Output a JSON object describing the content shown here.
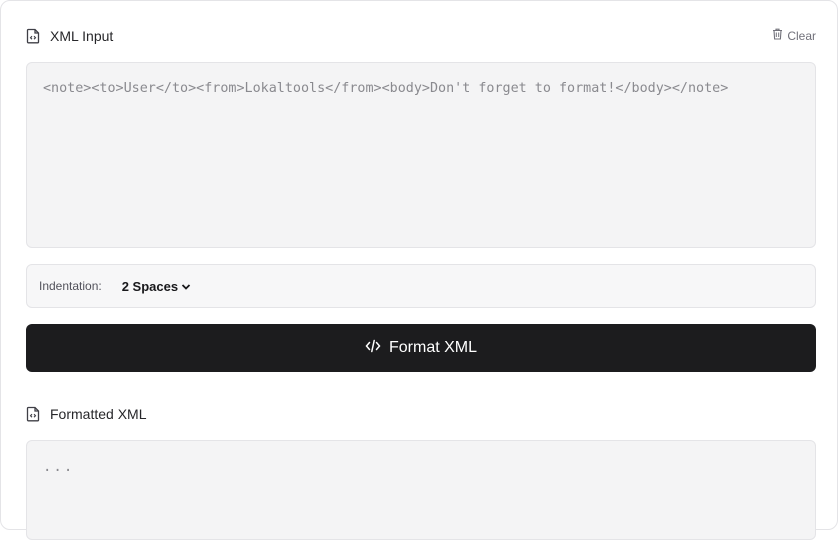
{
  "input_section": {
    "title": "XML Input",
    "clear_label": "Clear",
    "placeholder": "<note><to>User</to><from>Lokaltools</from><body>Don't forget to format!</body></note>",
    "value": ""
  },
  "options": {
    "indentation_label": "Indentation:",
    "indentation_selected": "2 Spaces"
  },
  "format_button": {
    "label": "Format XML"
  },
  "output_section": {
    "title": "Formatted XML",
    "placeholder": "..."
  },
  "icons": {
    "input_title_icon": "file-code-icon",
    "clear_icon": "trash-icon",
    "select_icon": "chevron-down-icon",
    "format_icon": "code-icon",
    "output_title_icon": "file-code-icon"
  },
  "colors": {
    "button_bg": "#1c1c1e",
    "input_bg": "#f4f4f5",
    "border": "#e4e4e7"
  }
}
